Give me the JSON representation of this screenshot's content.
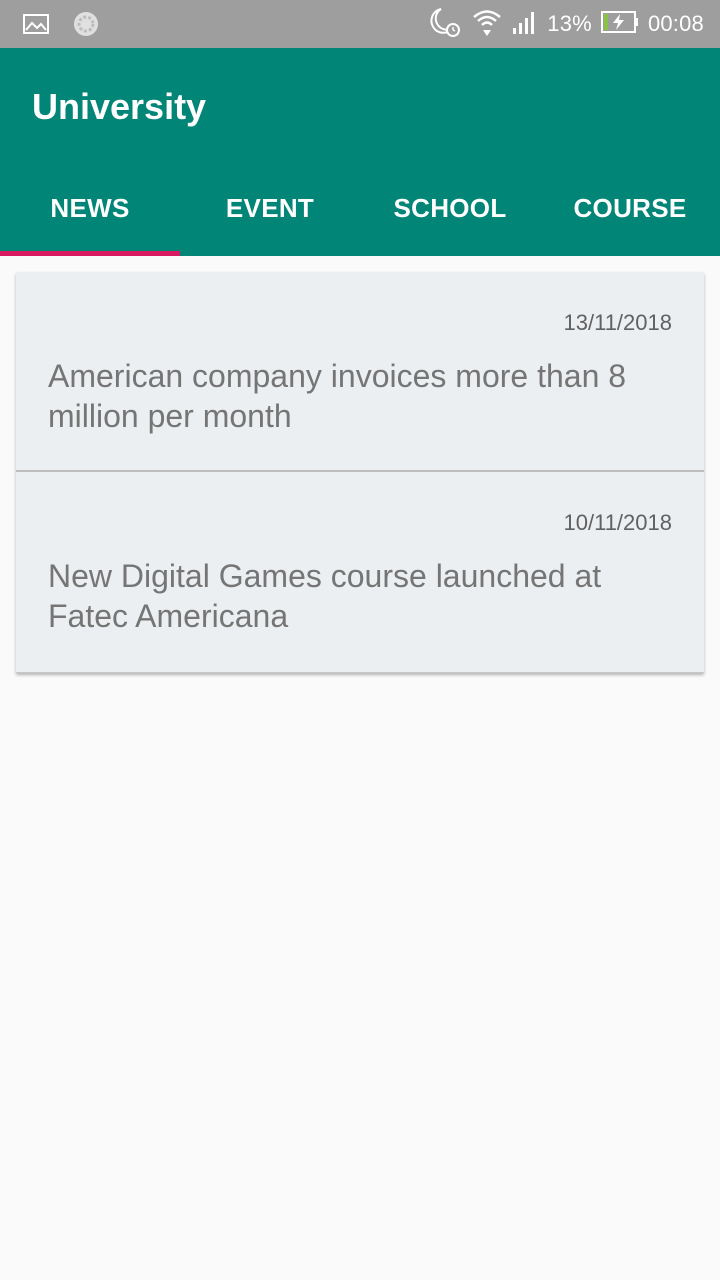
{
  "status_bar": {
    "battery_percent": "13%",
    "time": "00:08",
    "icons": [
      "image-icon",
      "sync-icon",
      "moon-alarm-icon",
      "wifi-icon",
      "signal-icon",
      "battery-charging-icon"
    ]
  },
  "app_bar": {
    "title": "University",
    "color": "#008577",
    "indicator_color": "#d81b60"
  },
  "tabs": [
    {
      "label": "NEWS",
      "active": true
    },
    {
      "label": "EVENT",
      "active": false
    },
    {
      "label": "SCHOOL",
      "active": false
    },
    {
      "label": "COURSE",
      "active": false
    }
  ],
  "news": [
    {
      "date": "13/11/2018",
      "title": "American company invoices more than 8 million per month"
    },
    {
      "date": "10/11/2018",
      "title": "New Digital Games course launched at Fatec Americana"
    }
  ]
}
